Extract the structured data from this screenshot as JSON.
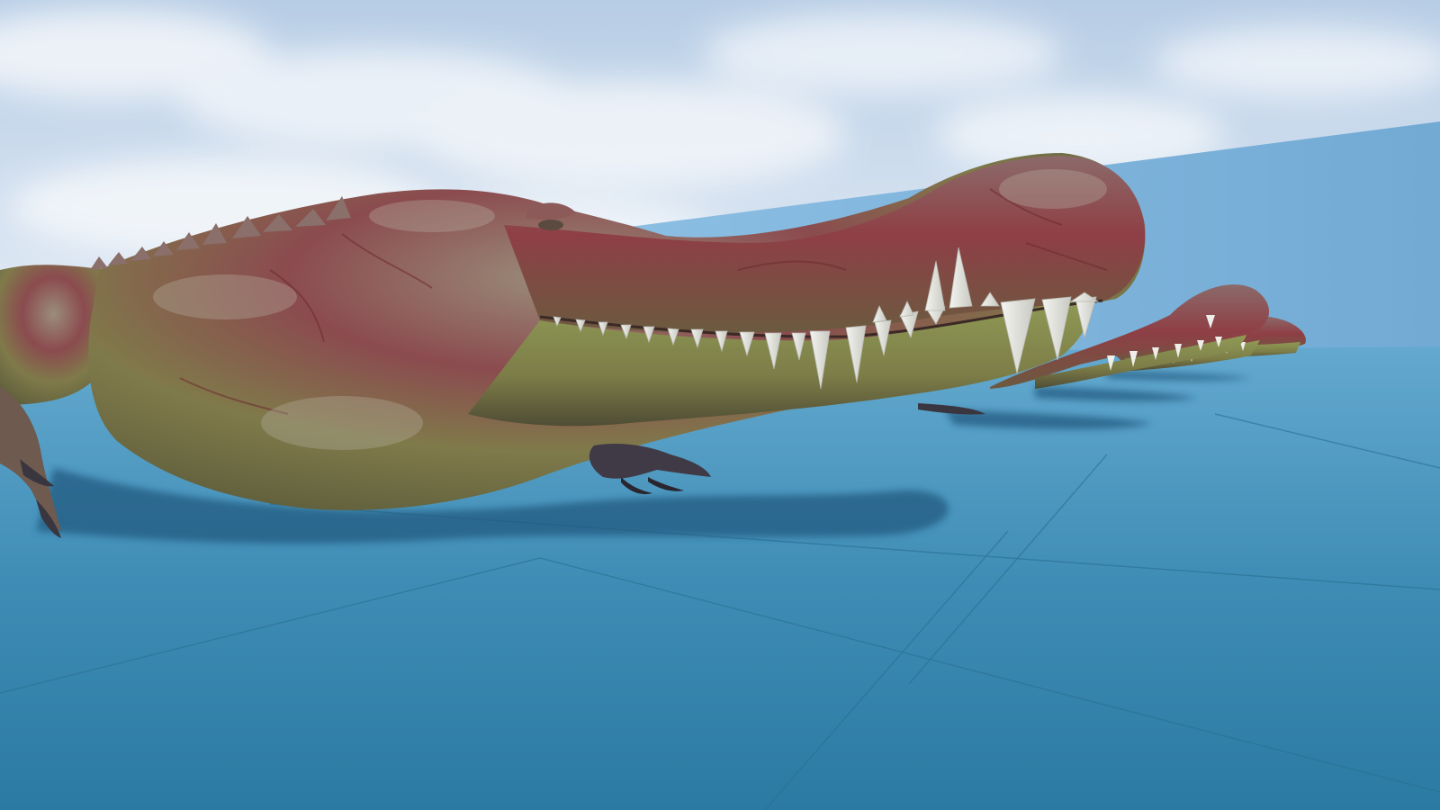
{
  "scene": {
    "subject": "crocodile-creatures",
    "creature_count": 4,
    "colors": {
      "sky_top": "#b9cfe6",
      "sky_bottom": "#e9eff7",
      "wall": "#7fb4dc",
      "floor_far": "#5ea4cc",
      "floor_near": "#2f7ea6",
      "floor_lines": "#2a6f93",
      "skin_red": "#8e3a40",
      "skin_olive": "#8c8a4a",
      "skin_grey": "#8d8f85",
      "teeth": "#e6e6e1",
      "claws": "#3a3640",
      "shadow": "#25567a"
    }
  }
}
